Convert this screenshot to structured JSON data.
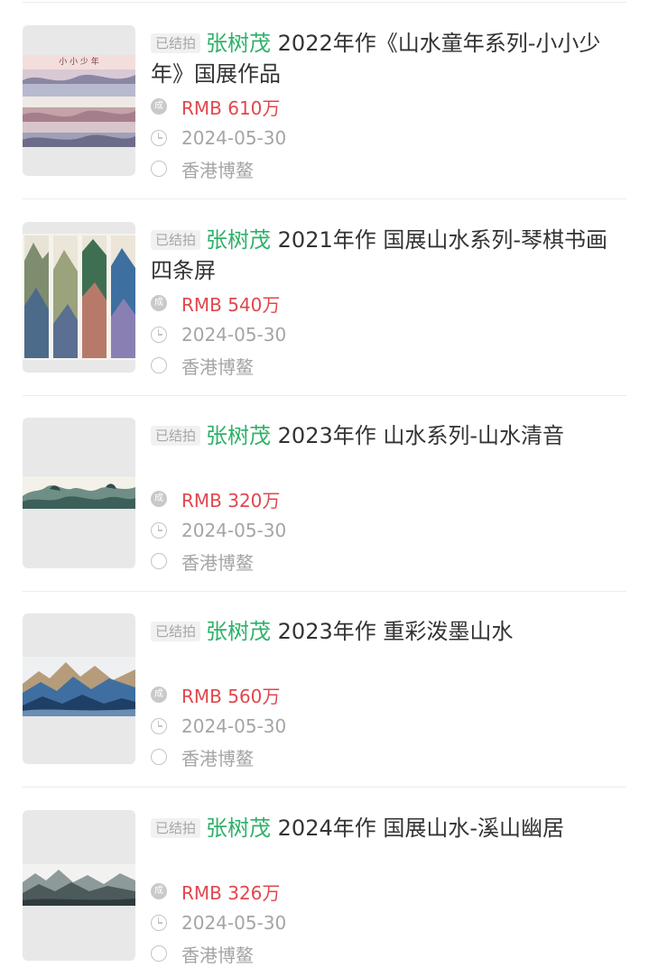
{
  "items": [
    {
      "status": "已结拍",
      "artist": "张树茂",
      "title": "2022年作《山水童年系列-小小少年》国展作品",
      "price": "RMB 610万",
      "date": "2024-05-30",
      "location": "香港博鳌",
      "price_icon": "deal-icon",
      "thumb_text": "小 小 少 年"
    },
    {
      "status": "已结拍",
      "artist": "张树茂",
      "title": "2021年作 国展山水系列-琴棋书画四条屏",
      "price": "RMB 540万",
      "date": "2024-05-30",
      "location": "香港博鳌",
      "price_icon": "deal-icon"
    },
    {
      "status": "已结拍",
      "artist": "张树茂",
      "title": "2023年作 山水系列-山水清音",
      "price": "RMB 320万",
      "date": "2024-05-30",
      "location": "香港博鳌",
      "price_icon": "deal-icon"
    },
    {
      "status": "已结拍",
      "artist": "张树茂",
      "title": "2023年作 重彩泼墨山水",
      "price": "RMB 560万",
      "date": "2024-05-30",
      "location": "香港博鳌",
      "price_icon": "deal-icon"
    },
    {
      "status": "已结拍",
      "artist": "张树茂",
      "title": "2024年作 国展山水-溪山幽居",
      "price": "RMB 326万",
      "date": "2024-05-30",
      "location": "香港博鳌",
      "price_icon": "deal-icon"
    }
  ],
  "icons": {
    "price": "deal-icon",
    "date": "clock-icon",
    "location": "location-icon",
    "deal_glyph": "成"
  },
  "colors": {
    "artist": "#2fb169",
    "price": "#e0474d",
    "muted": "#a5a5a5"
  }
}
